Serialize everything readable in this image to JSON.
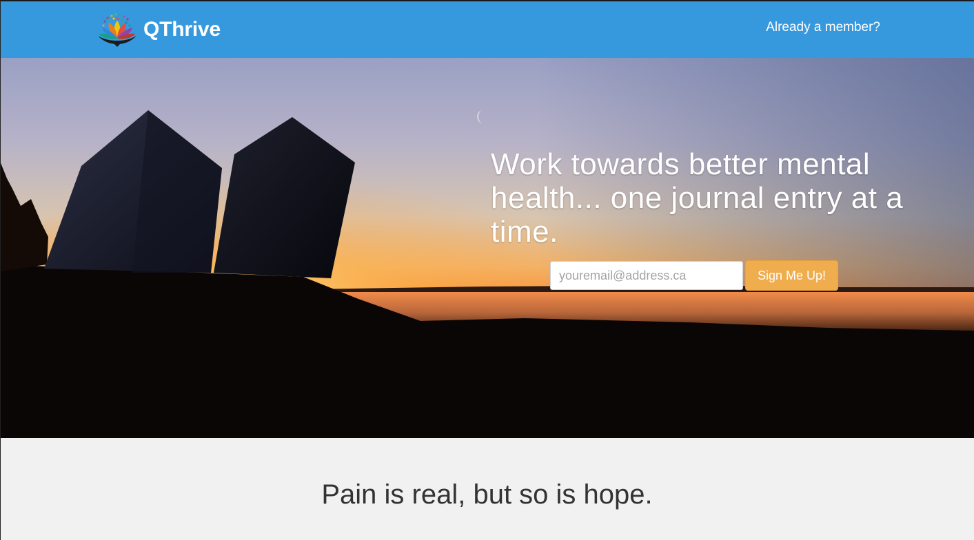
{
  "navbar": {
    "brand_name": "QThrive",
    "member_link": "Already a member?",
    "logo_icon": "lotus-logo-icon",
    "background_color": "#3799dd"
  },
  "hero": {
    "headline": "Work towards better mental health... one journal entry at a time.",
    "email_placeholder": "youremail@address.ca",
    "signup_button": "Sign Me Up!",
    "button_color": "#f0ad4e"
  },
  "tagline": {
    "text": "Pain is real, but so is hope."
  }
}
